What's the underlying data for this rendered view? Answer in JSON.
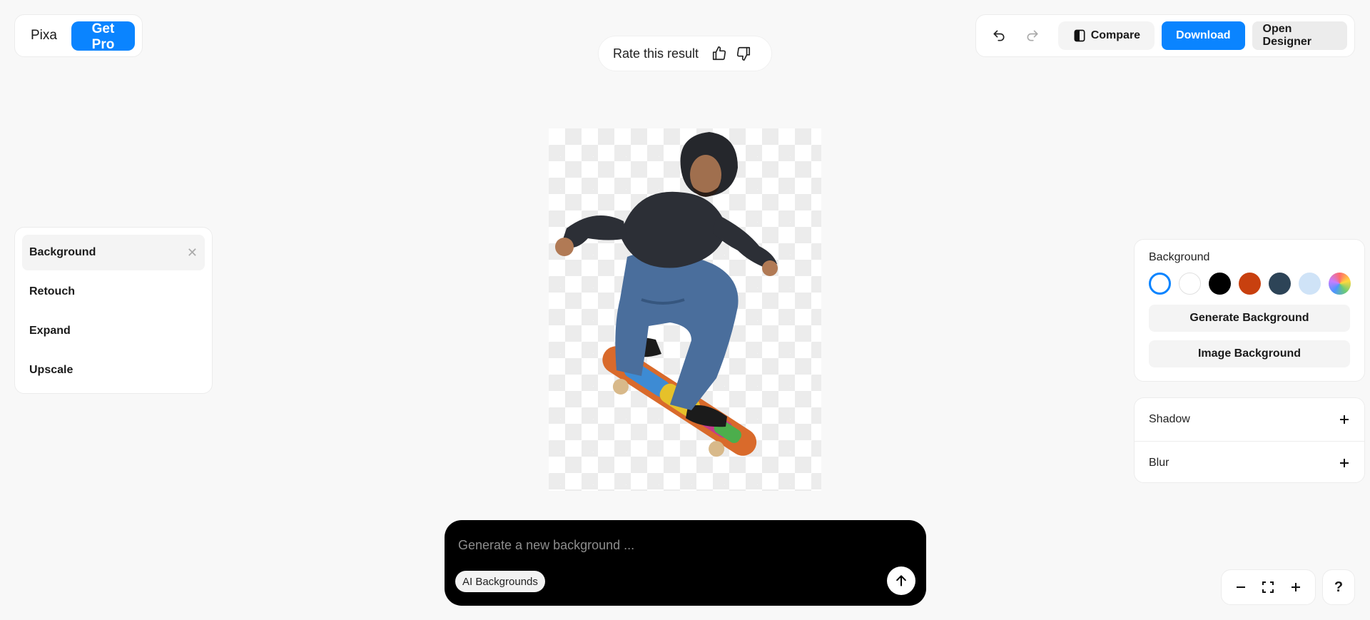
{
  "brand": {
    "name": "Pixa",
    "pro_label": "Get Pro"
  },
  "rating": {
    "label": "Rate this result",
    "like_icon": "thumbs-up-icon",
    "dislike_icon": "thumbs-down-icon"
  },
  "toolbar": {
    "undo_icon": "undo-icon",
    "redo_icon": "redo-icon",
    "compare_label": "Compare",
    "download_label": "Download",
    "designer_label": "Open Designer"
  },
  "tools": {
    "items": [
      {
        "label": "Background",
        "active": true
      },
      {
        "label": "Retouch"
      },
      {
        "label": "Expand"
      },
      {
        "label": "Upscale"
      }
    ],
    "close_glyph": "✕"
  },
  "canvas": {
    "subject": "skateboarder-cutout"
  },
  "prompt": {
    "placeholder": "Generate a new background ...",
    "chip_label": "AI Backgrounds",
    "send_icon": "arrow-up-icon"
  },
  "background_panel": {
    "title": "Background",
    "swatches": [
      {
        "name": "transparent",
        "color": "#ffffff",
        "selected": true
      },
      {
        "name": "white",
        "color": "#ffffff"
      },
      {
        "name": "black",
        "color": "#000000"
      },
      {
        "name": "orange",
        "color": "#c8400f"
      },
      {
        "name": "slate",
        "color": "#2d4457"
      },
      {
        "name": "light-blue",
        "color": "#cfe3f7"
      },
      {
        "name": "gradient",
        "color": "multicolor"
      }
    ],
    "generate_label": "Generate Background",
    "image_label": "Image Background"
  },
  "effects": [
    {
      "label": "Shadow"
    },
    {
      "label": "Blur"
    }
  ],
  "zoom": {
    "out_icon": "minus-icon",
    "fit_icon": "fullscreen-icon",
    "in_icon": "plus-icon"
  },
  "help": {
    "label": "?"
  },
  "colors": {
    "accent": "#0a84ff",
    "prompt_bg": "#000000",
    "page_bg": "#f8f8f8"
  }
}
